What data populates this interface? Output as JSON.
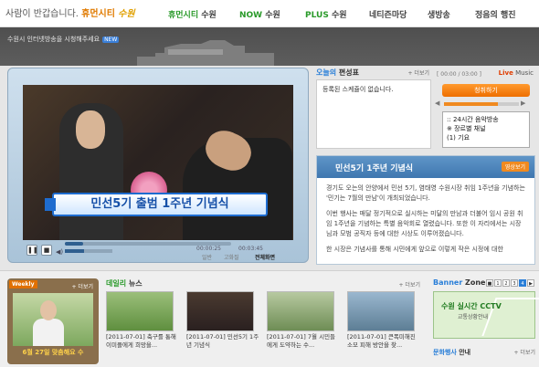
{
  "logo": {
    "greeting": "사람이 반갑습니다.",
    "brand": "휴먼시티",
    "brand2": "수원"
  },
  "nav": {
    "items": [
      {
        "label": "휴먼시티 수원",
        "green": "휴먼시티",
        "rest": " 수원"
      },
      {
        "label": "NOW 수원",
        "green": "NOW",
        "rest": " 수원"
      },
      {
        "label": "PLUS 수원",
        "green": "PLUS",
        "rest": " 수원"
      },
      {
        "label": "네티즌마당"
      },
      {
        "label": "생방송"
      },
      {
        "label": "정음의 행진"
      }
    ]
  },
  "banner": {
    "notice": "수원시 인터넷방송을 시청해주세요",
    "new_badge": "NEW"
  },
  "video": {
    "caption": "민선5기 출범 1주년 기념식",
    "time_current": "00:00:25",
    "time_total": "00:03:45",
    "progress": 0.11,
    "volume": 0.4,
    "modes": [
      "일반",
      "고화질",
      "전체화면"
    ],
    "active_mode": "전체화면",
    "play_icon": "pause-icon",
    "stop_icon": "stop-icon"
  },
  "schedule": {
    "title_accent": "오늘의",
    "title_rest": " 편성표",
    "more": "+ 더보기",
    "empty_text": "등록된 스케쥴이 없습니다."
  },
  "music": {
    "clock": "[ 00:00 / 03:00 ]",
    "label_accent": "Live",
    "label_rest": " Music",
    "listen_button": "청취하기",
    "volume": 0.72,
    "list": [
      ":: 24시간 음악방송",
      "※ 장르별 채널",
      "(1) 기요"
    ]
  },
  "article": {
    "title": "민선5기 1주년 기념식",
    "more": "영상보기",
    "paragraphs": [
      "경기도 오는의 안양에서 민선 5기, 염태영 수원시장 취임 1주년을 기념하는 '민기는 7월의 만남'이 개최되었습니다.",
      "이번 행사는 매달 정기적으로 실시하는 미달의 만남과 더불어 임시 공원 취임 1주년을 기념하는 특별 음악회로 열렸습니다. 또한 이 자리에서는 시장님과 모범 공직자 등에 대한 시상도 이루어졌습니다.",
      "한 시장은 기념사를 통해 시민에게 앞으로 이렇게 작은 시정에 대한"
    ]
  },
  "weekly": {
    "tag": "Weekly",
    "more": "+ 더보기",
    "caption": "6월 27일 맞춤해요 수"
  },
  "daily": {
    "title_accent": "데일리",
    "title_rest": " 뉴스",
    "more": "+ 더보기",
    "items": [
      {
        "text": "[2011-07-01] 축구를 통해 이미플에게 희망을..."
      },
      {
        "text": "[2011-07-01] 민선5기 1주년 기념식"
      },
      {
        "text": "[2011-07-01] 7월 시민들에게 도약하는 수..."
      },
      {
        "text": "[2011-07-01] 큰폭미해진 소모 피해 방안을 찾..."
      }
    ]
  },
  "banner_zone": {
    "title_accent": "Banner",
    "title_rest": " Zone",
    "pages": [
      "■",
      "1",
      "2",
      "3",
      "4",
      "▶"
    ],
    "active_page": "4",
    "cctv_title": "수원 실시간 CCTV",
    "cctv_sub": "교통상황안내",
    "culture_accent": "문화행사",
    "culture_rest": " 안내",
    "more": "+ 더보기"
  }
}
